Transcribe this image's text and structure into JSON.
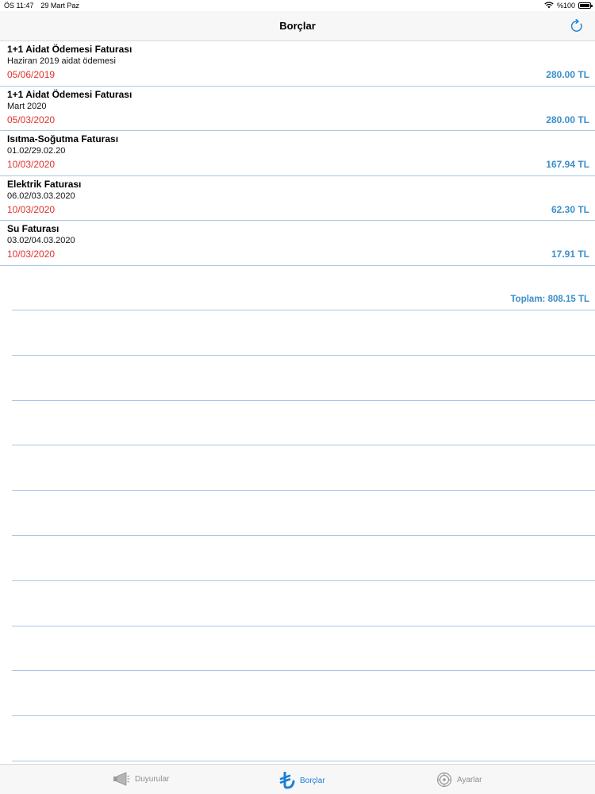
{
  "status_bar": {
    "time": "ÖS 11:47",
    "date": "29 Mart Paz",
    "battery": "%100"
  },
  "nav": {
    "title": "Borçlar",
    "refresh_icon": "refresh-icon"
  },
  "bills": [
    {
      "title": "1+1 Aidat Ödemesi Faturası",
      "subtitle": "Haziran 2019 aidat ödemesi",
      "date": "05/06/2019",
      "amount": "280.00 TL"
    },
    {
      "title": "1+1 Aidat Ödemesi Faturası",
      "subtitle": "Mart 2020",
      "date": "05/03/2020",
      "amount": "280.00 TL"
    },
    {
      "title": "Isıtma-Soğutma Faturası",
      "subtitle": "01.02/29.02.20",
      "date": "10/03/2020",
      "amount": "167.94 TL"
    },
    {
      "title": "Elektrik Faturası",
      "subtitle": "06.02/03.03.2020",
      "date": "10/03/2020",
      "amount": "62.30 TL"
    },
    {
      "title": "Su Faturası",
      "subtitle": "03.02/04.03.2020",
      "date": "10/03/2020",
      "amount": "17.91 TL"
    }
  ],
  "total": "Toplam: 808.15 TL",
  "tabs": [
    {
      "label": "Duyurular",
      "icon": "megaphone-icon"
    },
    {
      "label": "Borçlar",
      "icon": "lira-icon",
      "active": true
    },
    {
      "label": "Ayarlar",
      "icon": "gear-icon"
    }
  ],
  "colors": {
    "accent": "#3a8fcb",
    "tab_active": "#1a7fd4",
    "date_red": "#e0322e",
    "separator": "#a9c6e4"
  }
}
